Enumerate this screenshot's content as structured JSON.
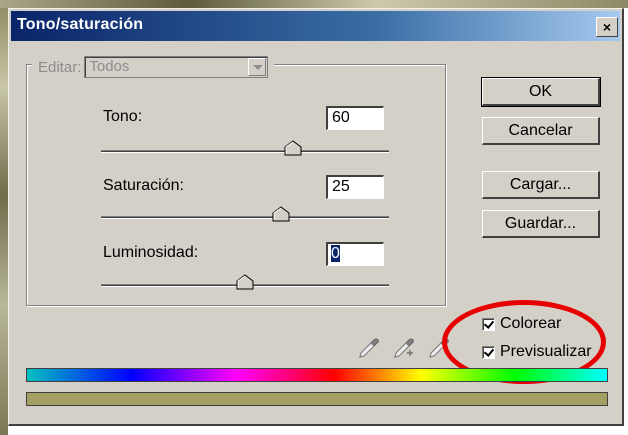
{
  "window": {
    "title": "Tono/saturación",
    "close_glyph": "×"
  },
  "edit": {
    "label": "Editar:",
    "selected": "Todos"
  },
  "sliders": [
    {
      "label": "Tono:",
      "value": "60",
      "min": -180,
      "max": 180,
      "num": 60
    },
    {
      "label": "Saturación:",
      "value": "25",
      "min": -100,
      "max": 100,
      "num": 25
    },
    {
      "label": "Luminosidad:",
      "value": "0",
      "min": -100,
      "max": 100,
      "num": 0
    }
  ],
  "buttons": {
    "ok": "OK",
    "cancel": "Cancelar",
    "load": "Cargar...",
    "save": "Guardar..."
  },
  "checkboxes": {
    "colorize": {
      "label": "Colorear",
      "checked": true
    },
    "preview": {
      "label": "Previsualizar",
      "checked": true
    }
  },
  "icons": [
    "eyedropper-icon",
    "eyedropper-plus-icon",
    "eyedropper-minus-icon"
  ],
  "colors": {
    "result_swatch": "#a4a063",
    "annotation_ring": "#e60000",
    "titlebar_start": "#0a246a",
    "titlebar_end": "#a6caf0"
  }
}
